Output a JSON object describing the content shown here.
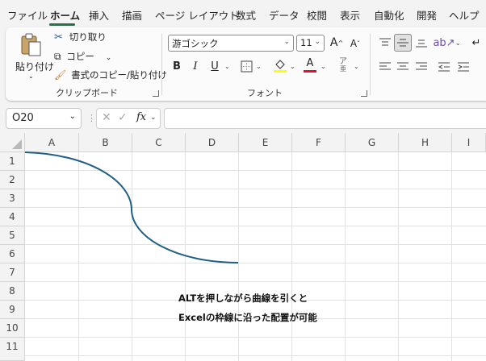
{
  "menu": {
    "tabs": [
      "ファイル",
      "ホーム",
      "挿入",
      "描画",
      "ページ レイアウト",
      "数式",
      "データ",
      "校閲",
      "表示",
      "自動化",
      "開発",
      "ヘルプ"
    ],
    "active_tab": "ホーム"
  },
  "ribbon": {
    "clipboard": {
      "paste_label": "貼り付け",
      "cut_label": "切り取り",
      "copy_label": "コピー",
      "format_painter_label": "書式のコピー/貼り付け",
      "group_label": "クリップボード"
    },
    "font": {
      "font_name": "游ゴシック",
      "font_size": "11",
      "bold": "B",
      "italic": "I",
      "underline": "U",
      "grow_font": "A",
      "shrink_font": "A",
      "font_color_letter": "A",
      "phonetic_letter": "ア",
      "phonetic_sub": "亜",
      "group_label": "フォント"
    },
    "colors": {
      "accent": "#217346",
      "highlight_yellow": "#ffff00",
      "font_red": "#e81123"
    }
  },
  "formula_bar": {
    "name_box_value": "O20",
    "fx_label": "fx",
    "formula_value": ""
  },
  "sheet": {
    "columns": [
      "A",
      "B",
      "C",
      "D",
      "E",
      "F",
      "G",
      "H",
      "I"
    ],
    "rows": [
      "1",
      "2",
      "3",
      "4",
      "5",
      "6",
      "7",
      "8",
      "9",
      "10",
      "11"
    ],
    "note_line1": "ALTを押しながら曲線を引くと",
    "note_line2": "Excelの枠線に沿った配置が可能",
    "curve_color": "#1f5f86"
  }
}
